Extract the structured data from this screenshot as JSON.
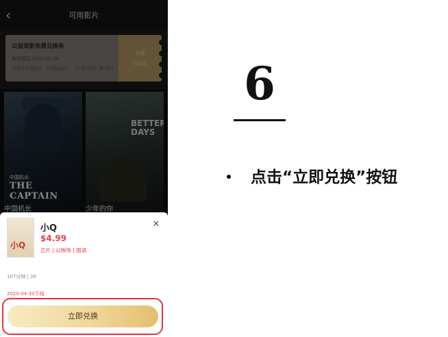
{
  "phone": {
    "nav_title": "可用影片",
    "back_glyph": "‹",
    "voucher": {
      "title": "公益观影免费兑换券",
      "validity": "有效期至2020.03.29",
      "rule": "可用于中国影片 《中国机长》 《少年的你》等 均可",
      "side_button": "兑换",
      "side_status": "已兑完"
    },
    "movies": [
      {
        "name": "中国机长",
        "poster_headline": "中国机长",
        "poster_subtitle": "THE CAPTAIN"
      },
      {
        "name": "少年的你",
        "poster_headline": "BETTER DAYS"
      }
    ],
    "sheet": {
      "poster_text": "小Q",
      "title": "小Q",
      "price": "$4.99",
      "tags": "正片 | 公映场 | 国语",
      "meta": "107分钟 | 2K",
      "deadline": "2020-04-30下线",
      "redeem_button": "立即兑换",
      "close_glyph": "✕"
    },
    "icons": {
      "back": "chevron-left-icon",
      "close": "close-icon"
    }
  },
  "slide": {
    "step_number": "6",
    "bullet": "•",
    "instruction": "点击“立即兑换”按钮"
  },
  "colors": {
    "accent_red": "#e8424d",
    "highlight_red": "#e8313a",
    "button_gold": "#f0d79a"
  }
}
